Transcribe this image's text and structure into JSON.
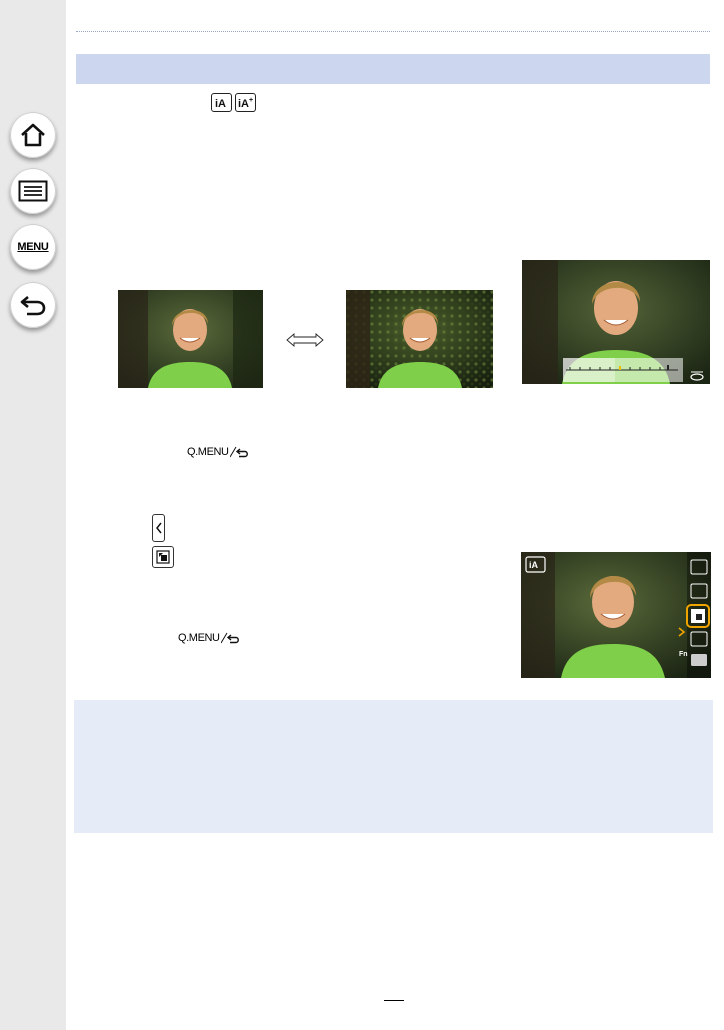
{
  "nav": {
    "home_icon": "home-icon",
    "list_icon": "list-icon",
    "menu_label": "MENU",
    "back_icon": "back-arrow-icon"
  },
  "icons": {
    "ia": "iA",
    "ia_plus": "iA+"
  },
  "photos": {
    "overlay_icon": "iA"
  },
  "qmenu_label_1": "Q.MENU",
  "qmenu_label_2": "Q.MENU",
  "side_menu": {
    "fn_label": "Fn"
  },
  "colors": {
    "sidebar": "#e9e9e9",
    "header_bar": "#ccd7ef",
    "note_box": "#e6ebf8",
    "highlight": "#f0a500"
  }
}
